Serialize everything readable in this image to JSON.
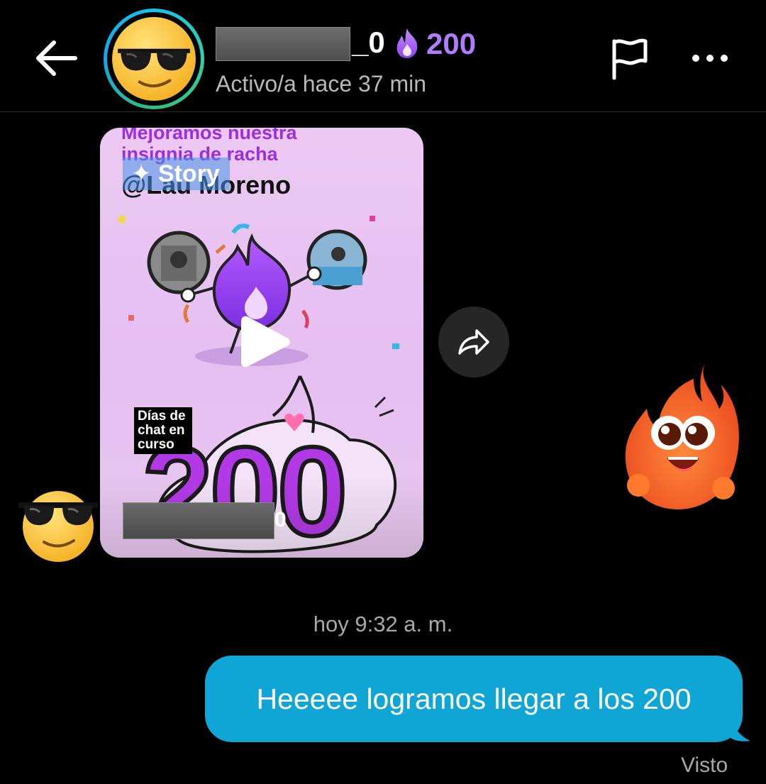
{
  "header": {
    "username_suffix": "_0",
    "streak_count": "200",
    "status": "Activo/a hace 37 min",
    "avatar_icon": "sunglasses-emoji",
    "back_icon": "back-arrow-icon",
    "report_icon": "flag-icon",
    "more_icon": "more-icon"
  },
  "story": {
    "line1": "Mejoramos nuestra",
    "line2": "insignia de racha",
    "mention": "@Lau Moreno",
    "chip_label": "✦ Story",
    "days_label": "Días de chat en curso",
    "big_number": "200",
    "redacted_tail": "0"
  },
  "message": {
    "timestamp": "hoy 9:32 a. m.",
    "text": "Heeeee logramos llegar a los 200",
    "seen": "Visto"
  },
  "colors": {
    "bubble": "#0fa6d6",
    "streak": "#b07cff",
    "story_bg": "#e6bff1",
    "accent_purple": "#b23ae6"
  }
}
